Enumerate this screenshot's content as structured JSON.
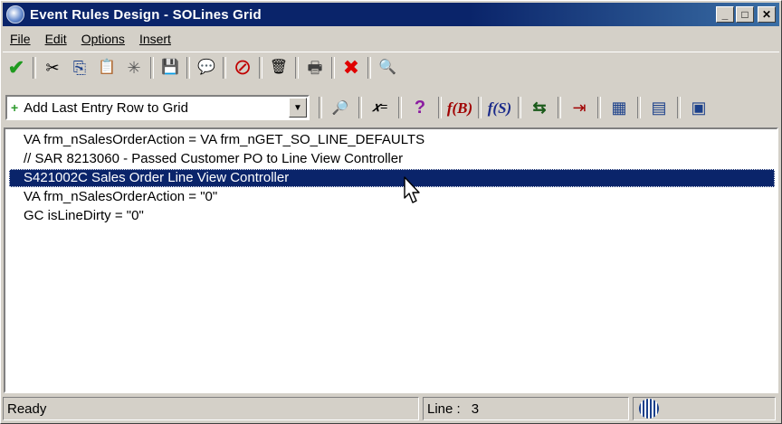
{
  "window": {
    "title": "Event Rules Design - SOLines Grid"
  },
  "title_controls": {
    "minimize": "_",
    "maximize": "□",
    "close": "✕"
  },
  "menu": [
    {
      "label": "File"
    },
    {
      "label": "Edit"
    },
    {
      "label": "Options"
    },
    {
      "label": "Insert"
    }
  ],
  "toolbar1": [
    {
      "icon": "check-icon",
      "glyph": "✔",
      "color": "#1f9a1f"
    },
    {
      "icon": "cut-icon",
      "glyph": "✂",
      "color": "#000000"
    },
    {
      "icon": "copy-icon",
      "glyph": "⎘",
      "color": "#1a3f8a"
    },
    {
      "icon": "paste-icon",
      "glyph": "📋",
      "color": "#8a6a1a"
    },
    {
      "icon": "special-paste-icon",
      "glyph": "✳",
      "color": "#5a5a5a"
    },
    {
      "icon": "save-icon",
      "glyph": "💾",
      "color": "#1a3f8a"
    },
    {
      "icon": "comment-icon",
      "glyph": "💬",
      "color": "#000000"
    },
    {
      "icon": "disable-icon",
      "glyph": "⊘",
      "color": "#c00000"
    },
    {
      "icon": "delete-icon",
      "glyph": "🗑",
      "color": "#6a6a00"
    },
    {
      "icon": "print-icon",
      "glyph": "🖶",
      "color": "#404040"
    },
    {
      "icon": "cancel-icon",
      "glyph": "✖",
      "color": "#e00000"
    },
    {
      "icon": "search-icon",
      "glyph": "🔍",
      "color": "#000000"
    }
  ],
  "statement_combo": {
    "value": "Add Last Entry Row to Grid",
    "prefix": "+"
  },
  "toolbar2": [
    {
      "icon": "find-icon",
      "glyph": "🔎",
      "cls": ""
    },
    {
      "icon": "assignment-icon",
      "glyph": "𝑥=",
      "cls": ""
    },
    {
      "icon": "if-icon",
      "glyph": "?",
      "cls": "qm"
    },
    {
      "icon": "business-function-icon",
      "glyph": "f(B)",
      "cls": "fb"
    },
    {
      "icon": "system-function-icon",
      "glyph": "f(S)",
      "cls": "fs"
    },
    {
      "icon": "table-io-icon",
      "glyph": "⇆",
      "cls": ""
    },
    {
      "icon": "insert-row-icon",
      "glyph": "⇥",
      "cls": ""
    },
    {
      "icon": "grid-icon",
      "glyph": "▦",
      "cls": ""
    },
    {
      "icon": "form-interconnect-icon",
      "glyph": "▤",
      "cls": ""
    },
    {
      "icon": "report-interconnect-icon",
      "glyph": "▣",
      "cls": ""
    }
  ],
  "editor": {
    "lines": [
      "VA frm_nSalesOrderAction = VA frm_nGET_SO_LINE_DEFAULTS",
      "// SAR 8213060 - Passed Customer PO to Line View Controller",
      "S421002C Sales Order Line View Controller",
      "VA frm_nSalesOrderAction = \"0\"",
      "GC isLineDirty = \"0\""
    ],
    "selected_index": 2
  },
  "status": {
    "text": "Ready",
    "line_label": "Line :",
    "line_value": "3"
  }
}
